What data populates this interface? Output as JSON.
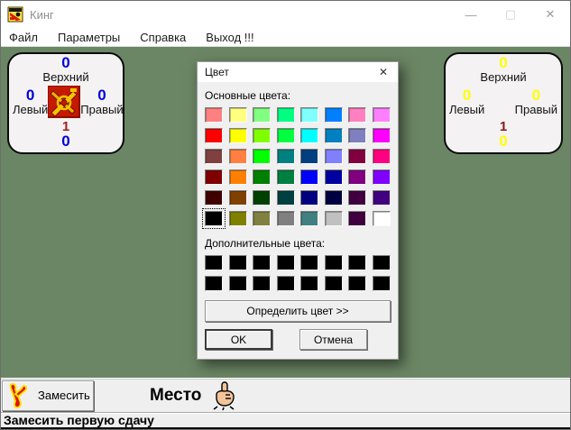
{
  "window": {
    "title": "Кинг",
    "menu": [
      "Файл",
      "Параметры",
      "Справка",
      "Выход !!!"
    ],
    "caption": {
      "minimize": "—",
      "maximize": "▢",
      "close": "✕"
    }
  },
  "colors": {
    "felt_green": "#41603b",
    "panel_bg": "#f4f2f2",
    "blue_score": "#0000dd",
    "yellow_score": "#ffff00",
    "round_red": "#9b2020"
  },
  "left_panel": {
    "top_label": "Верхний",
    "left_label": "Левый",
    "right_label": "Правый",
    "top_score": "0",
    "left_score": "0",
    "right_score": "0",
    "bottom_score": "0",
    "round": "1",
    "score_color": "#0000dd",
    "round_color": "#a02020"
  },
  "right_panel": {
    "top_label": "Верхний",
    "left_label": "Левый",
    "right_label": "Правый",
    "top_score": "0",
    "left_score": "0",
    "right_score": "0",
    "bottom_score": "0",
    "round": "1",
    "score_color": "#ffff00",
    "round_color": "#8b1a1a"
  },
  "dialog": {
    "title": "Цвет",
    "close_glyph": "✕",
    "basic_label": "Основные цвета:",
    "custom_label": "Дополнительные цвета:",
    "define_button": "Определить цвет >>",
    "ok_button": "OK",
    "cancel_button": "Отмена",
    "selected_index": 40,
    "basic_colors": [
      "#FF8080",
      "#FFFF80",
      "#80FF80",
      "#00FF80",
      "#80FFFF",
      "#0080FF",
      "#FF80C0",
      "#FF80FF",
      "#FF0000",
      "#FFFF00",
      "#80FF00",
      "#00FF40",
      "#00FFFF",
      "#0080C0",
      "#8080C0",
      "#FF00FF",
      "#804040",
      "#FF8040",
      "#00FF00",
      "#008080",
      "#004080",
      "#8080FF",
      "#800040",
      "#FF0080",
      "#800000",
      "#FF8000",
      "#008000",
      "#008040",
      "#0000FF",
      "#0000A0",
      "#800080",
      "#8000FF",
      "#400000",
      "#804000",
      "#004000",
      "#004040",
      "#000080",
      "#000040",
      "#400040",
      "#400080",
      "#000000",
      "#808000",
      "#808040",
      "#808080",
      "#408080",
      "#C0C0C0",
      "#400040",
      "#FFFFFF"
    ],
    "custom_colors": [
      "#000000",
      "#000000",
      "#000000",
      "#000000",
      "#000000",
      "#000000",
      "#000000",
      "#000000",
      "#000000",
      "#000000",
      "#000000",
      "#000000",
      "#000000",
      "#000000",
      "#000000",
      "#000000"
    ]
  },
  "toolbar": {
    "shuffle_button": "Замесить",
    "place_label": "Место"
  },
  "statusbar": {
    "text": "Замесить первую сдачу"
  }
}
